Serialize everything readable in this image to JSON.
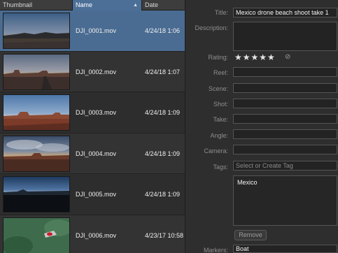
{
  "list": {
    "columns": {
      "thumbnail": "Thumbnail",
      "name": "Name",
      "date": "Date"
    },
    "rows": [
      {
        "name": "DJI_0001.mov",
        "date": "4/24/18 1:06",
        "thumbnail": "desert-sunrise-thumbnail"
      },
      {
        "name": "DJI_0002.mov",
        "date": "4/24/18 1:07",
        "thumbnail": "desert-road-thumbnail"
      },
      {
        "name": "DJI_0003.mov",
        "date": "4/24/18 1:09",
        "thumbnail": "red-desert-mesa-thumbnail"
      },
      {
        "name": "DJI_0004.mov",
        "date": "4/24/18 1:09",
        "thumbnail": "cloudy-desert-thumbnail"
      },
      {
        "name": "DJI_0005.mov",
        "date": "4/24/18 1:09",
        "thumbnail": "dark-horizon-thumbnail"
      },
      {
        "name": "DJI_0006.mov",
        "date": "4/23/17 10:58",
        "thumbnail": "boat-on-water-thumbnail"
      }
    ],
    "selected_index": 0,
    "selected_color": "#4b6c92"
  },
  "inspector": {
    "title_label": "Title:",
    "title_value": "Mexico drone beach shoot take 1",
    "description_label": "Description:",
    "rating_label": "Rating:",
    "rating_stars": "★★★★★",
    "rating_value": 5,
    "no_rating_icon": "⊘",
    "reel_label": "Reel:",
    "scene_label": "Scene:",
    "shot_label": "Shot:",
    "take_label": "Take:",
    "angle_label": "Angle:",
    "camera_label": "Camera:",
    "tags_label": "Tags:",
    "tags_placeholder": "Select or Create Tag",
    "tags": [
      "Mexico"
    ],
    "remove_button": "Remove",
    "markers_label": "Markers:",
    "markers_value": "Boat"
  }
}
